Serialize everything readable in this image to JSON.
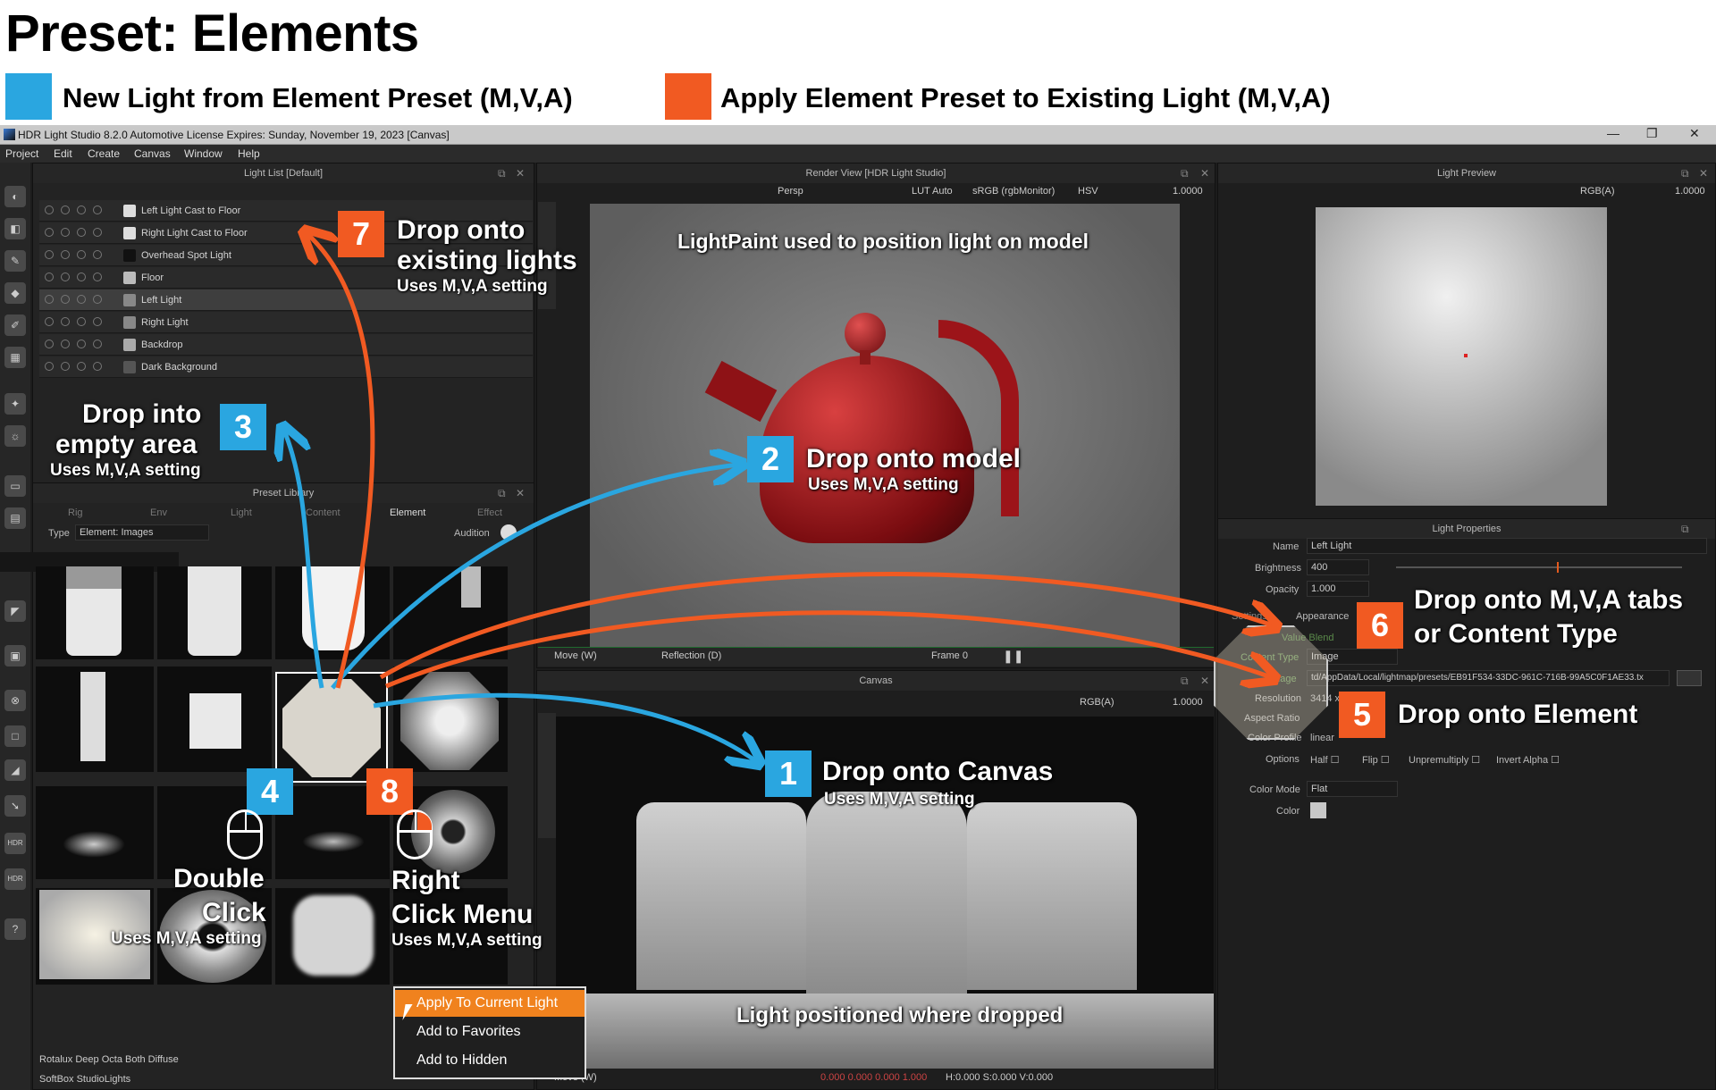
{
  "header": {
    "title": "Preset: Elements",
    "legend": [
      {
        "color": "#2aa6e0",
        "label": "New Light from Element Preset (M,V,A)"
      },
      {
        "color": "#f15a22",
        "label": "Apply Element Preset to Existing Light (M,V,A)"
      }
    ]
  },
  "app": {
    "window_title": "HDR Light Studio 8.2.0  Automotive License Expires: Sunday, November 19, 2023  [Canvas]",
    "menu": [
      "Project",
      "Edit",
      "Create",
      "Canvas",
      "Window",
      "Help"
    ],
    "light_list": {
      "title": "Light List [Default]",
      "items": [
        "Left Light Cast to Floor",
        "Right Light Cast to Floor",
        "Overhead Spot Light",
        "Floor",
        "Left Light",
        "Right Light",
        "Backdrop",
        "Dark Background"
      ],
      "selected": "Left Light"
    },
    "preset_library": {
      "title": "Preset Library",
      "tabs": [
        "Rig",
        "Env",
        "Light",
        "Content",
        "Element",
        "Effect"
      ],
      "active_tab": "Element",
      "type_label": "Type",
      "type_value": "Element: Images",
      "audition_label": "Audition",
      "footer": [
        "Rotalux Deep Octa Both Diffuse",
        "SoftBox StudioLights"
      ]
    },
    "render_view": {
      "title": "Render View [HDR Light Studio]",
      "camera": "Persp",
      "lut": "LUT Auto",
      "color_space": "sRGB (rgbMonitor)",
      "mode": "HSV",
      "exposure": "1.0000",
      "caption": "LightPaint used to position light on model",
      "move_tool": "Move (W)",
      "paint_mode": "Reflection (D)",
      "frame": "Frame 0"
    },
    "canvas": {
      "title": "Canvas",
      "channel": "RGB(A)",
      "exposure": "1.0000",
      "caption": "Light positioned where dropped",
      "move_tool": "Move (W)",
      "status_rgb": "0.000 0.000 0.000 1.000",
      "status_hsv": "H:0.000 S:0.000 V:0.000"
    },
    "light_preview": {
      "title": "Light Preview",
      "channel": "RGB(A)",
      "exposure": "1.0000"
    },
    "light_properties": {
      "title": "Light Properties",
      "name_label": "Name",
      "name_value": "Left Light",
      "brightness_label": "Brightness",
      "brightness_value": "400",
      "opacity_label": "Opacity",
      "opacity_value": "1.000",
      "tabs": [
        "Settings",
        "Appearance"
      ],
      "value_blend": "Value Blend",
      "content_type_label": "Content Type",
      "content_type_value": "Image",
      "image_label": "Image",
      "image_value": "td/AppData/Local/lightmap/presets/EB91F534-33DC-961C-716B-99A5C0F1AE33.tx",
      "resolution_label": "Resolution",
      "resolution_value": "3414 x",
      "aspect_label": "Aspect Ratio",
      "color_profile_label": "Color Profile",
      "color_profile_value": "linear",
      "options_label": "Options",
      "options": [
        "Half",
        "Flip",
        "Unpremultiply",
        "Invert Alpha"
      ],
      "color_mode_label": "Color Mode",
      "color_mode_value": "Flat",
      "color_label": "Color"
    }
  },
  "annotations": [
    {
      "num": "1",
      "color": "blue",
      "title": "Drop onto Canvas",
      "sub": "Uses M,V,A setting"
    },
    {
      "num": "2",
      "color": "blue",
      "title": "Drop onto model",
      "sub": "Uses M,V,A setting"
    },
    {
      "num": "3",
      "color": "blue",
      "title": "Drop into empty area",
      "sub": "Uses M,V,A setting"
    },
    {
      "num": "4",
      "color": "blue",
      "title": "Double Click",
      "sub": "Uses M,V,A setting"
    },
    {
      "num": "5",
      "color": "orange",
      "title": "Drop onto Element",
      "sub": ""
    },
    {
      "num": "6",
      "color": "orange",
      "title": "Drop onto M,V,A tabs or Content Type",
      "sub": ""
    },
    {
      "num": "7",
      "color": "orange",
      "title": "Drop onto existing lights",
      "sub": "Uses M,V,A setting"
    },
    {
      "num": "8",
      "color": "orange",
      "title": "Right Click Menu",
      "sub": "Uses M,V,A setting"
    }
  ],
  "context_menu": [
    "Apply To Current Light",
    "Add to Favorites",
    "Add to Hidden"
  ],
  "colors": {
    "blue": "#2aa6e0",
    "orange": "#f15a22",
    "menu_highlight": "#f0821e"
  }
}
